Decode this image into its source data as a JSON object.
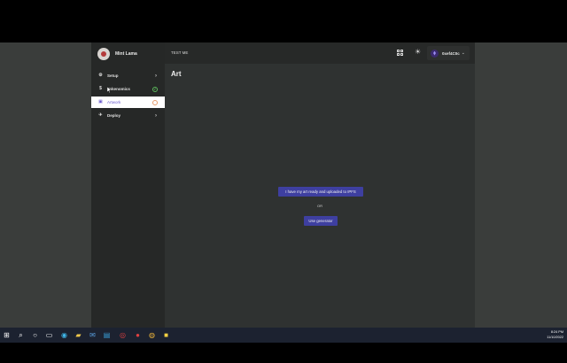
{
  "profile": {
    "name": "Mint Lama"
  },
  "sidebar": {
    "items": [
      {
        "label": "Setup",
        "icon": "gear-icon"
      },
      {
        "label": "Tokenomics",
        "icon": "dollar-icon"
      },
      {
        "label": "Artwork",
        "icon": "image-icon"
      },
      {
        "label": "Deploy",
        "icon": "rocket-icon"
      }
    ]
  },
  "topbar": {
    "title": "TEST ME",
    "wallet_address": "0xef4C0c"
  },
  "main": {
    "title": "Art",
    "upload_button": "I have my art ready and uploaded to IPFS",
    "or_label": "OR",
    "generator_button": "Use generator"
  },
  "taskbar": {
    "time": "8:24 PM",
    "date": "11/10/2022"
  },
  "colors": {
    "accent": "#3e3fa0",
    "active_text": "#6a5acd",
    "success": "#5cb85c"
  }
}
